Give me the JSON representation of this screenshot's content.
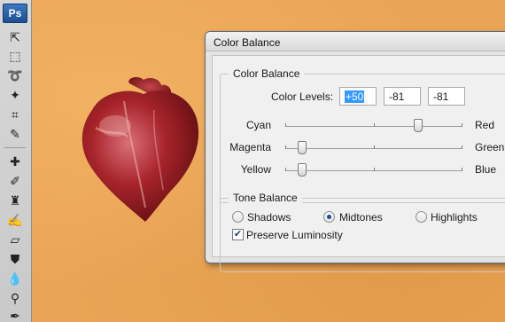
{
  "app": {
    "logo": "Ps",
    "tools": [
      {
        "icon": "move-tool-icon",
        "glyph": "⇱"
      },
      {
        "icon": "marquee-tool-icon",
        "glyph": "⬚"
      },
      {
        "icon": "lasso-tool-icon",
        "glyph": "➰"
      },
      {
        "icon": "magic-wand-tool-icon",
        "glyph": "✦"
      },
      {
        "icon": "crop-tool-icon",
        "glyph": "⌗"
      },
      {
        "icon": "eyedropper-tool-icon",
        "glyph": "✎"
      },
      {
        "icon": "healing-brush-tool-icon",
        "glyph": "✚"
      },
      {
        "icon": "brush-tool-icon",
        "glyph": "✐"
      },
      {
        "icon": "clone-stamp-tool-icon",
        "glyph": "♜"
      },
      {
        "icon": "history-brush-tool-icon",
        "glyph": "✍"
      },
      {
        "icon": "eraser-tool-icon",
        "glyph": "▱"
      },
      {
        "icon": "paint-bucket-tool-icon",
        "glyph": "⛊"
      },
      {
        "icon": "blur-tool-icon",
        "glyph": "💧"
      },
      {
        "icon": "dodge-tool-icon",
        "glyph": "⚲"
      },
      {
        "icon": "pen-tool-icon",
        "glyph": "✒"
      }
    ]
  },
  "dialog": {
    "title": "Color Balance",
    "color_balance": {
      "legend": "Color Balance",
      "levels_label": "Color Levels:",
      "levels": [
        "+50",
        "-81",
        "-81"
      ],
      "sliders": [
        {
          "left": "Cyan",
          "right": "Red",
          "value": 50
        },
        {
          "left": "Magenta",
          "right": "Green",
          "value": -81
        },
        {
          "left": "Yellow",
          "right": "Blue",
          "value": -81
        }
      ]
    },
    "tone_balance": {
      "legend": "Tone Balance",
      "options": [
        "Shadows",
        "Midtones",
        "Highlights"
      ],
      "selected": "Midtones",
      "preserve_label": "Preserve Luminosity",
      "preserve_checked": true
    }
  },
  "colors": {
    "canvas": "#e9a555",
    "selection": "#3399ff",
    "heart": "#9c1f24"
  }
}
